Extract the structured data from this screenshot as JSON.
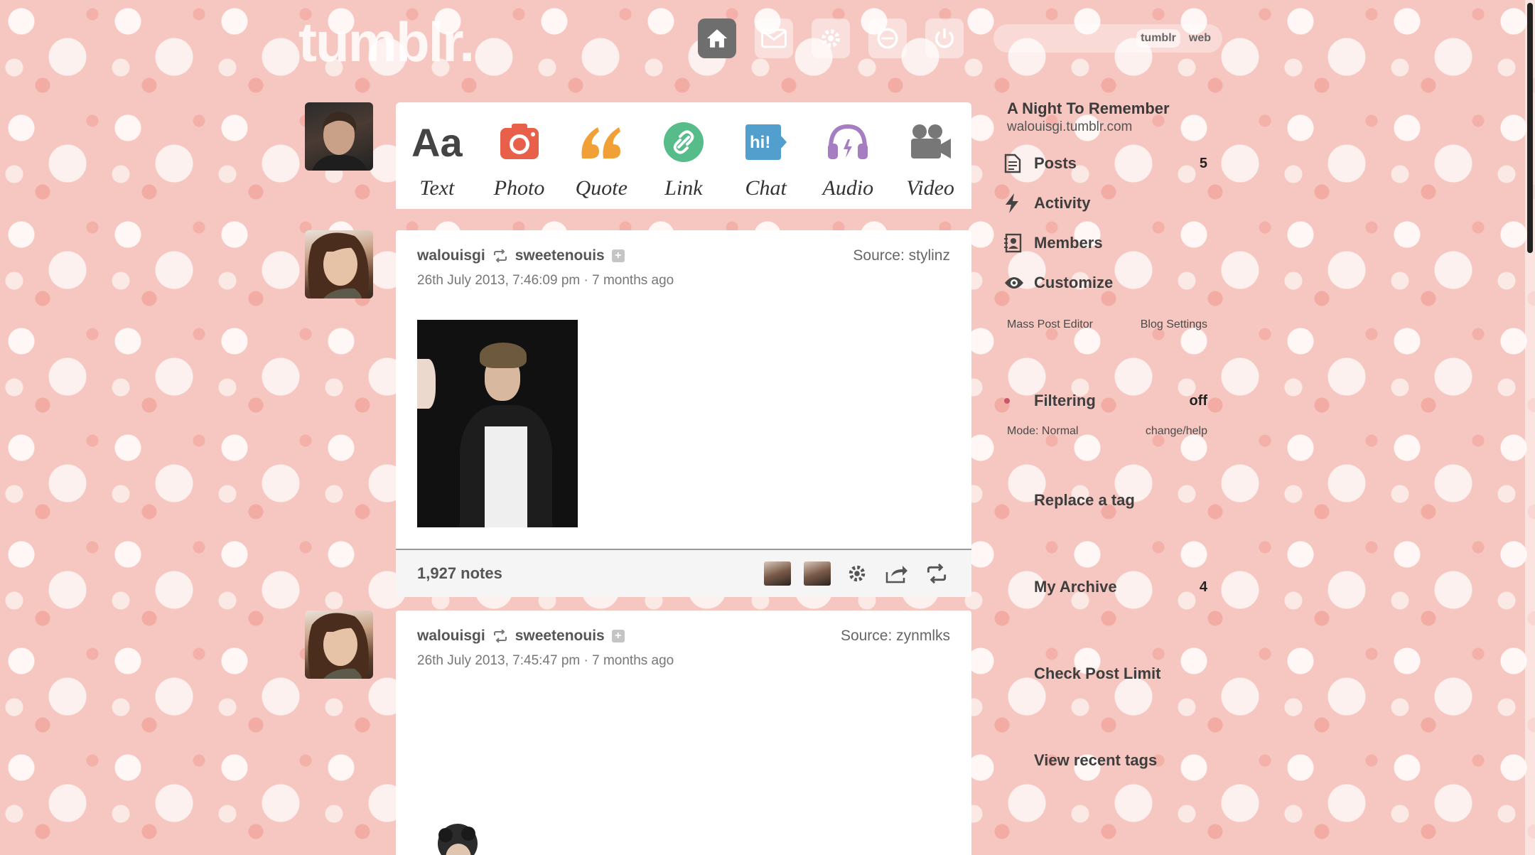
{
  "header": {
    "logo": "tumblr.",
    "nav": [
      {
        "name": "dashboard",
        "icon": "home-icon"
      },
      {
        "name": "inbox",
        "icon": "envelope-icon"
      },
      {
        "name": "settings",
        "icon": "gear-icon"
      },
      {
        "name": "help",
        "icon": "circle-icon"
      },
      {
        "name": "log-out",
        "icon": "power-icon"
      }
    ],
    "search": {
      "placeholder": "",
      "tumblr_label": "tumblr",
      "web_label": "web"
    }
  },
  "post_types": [
    {
      "label": "Text",
      "icon": "text-icon",
      "color": "#444444"
    },
    {
      "label": "Photo",
      "icon": "camera-icon",
      "color": "#e8604a"
    },
    {
      "label": "Quote",
      "icon": "quote-icon",
      "color": "#f0a035"
    },
    {
      "label": "Link",
      "icon": "link-icon",
      "color": "#56bc8a"
    },
    {
      "label": "Chat",
      "icon": "chat-icon",
      "color": "#529ecc"
    },
    {
      "label": "Audio",
      "icon": "headphones-icon",
      "color": "#a77dc2"
    },
    {
      "label": "Video",
      "icon": "video-camera-icon",
      "color": "#777777"
    }
  ],
  "posts": [
    {
      "author": "walouisgi",
      "reblogged_from": "sweetenouis",
      "date": "26th July 2013, 7:46:09 pm",
      "ago": "7 months ago",
      "source_label": "Source:",
      "source": "stylinz",
      "notes": "1,927 notes"
    },
    {
      "author": "walouisgi",
      "reblogged_from": "sweetenouis",
      "date": "26th July 2013, 7:45:47 pm",
      "ago": "7 months ago",
      "source_label": "Source:",
      "source": "zynmlks"
    }
  ],
  "sidebar": {
    "blog_title": "A Night To Remember",
    "blog_url": "walouisgi.tumblr.com",
    "menu": [
      {
        "label": "Posts",
        "count": "5",
        "icon": "document-icon"
      },
      {
        "label": "Activity",
        "count": "",
        "icon": "lightning-icon"
      },
      {
        "label": "Members",
        "count": "",
        "icon": "members-icon"
      },
      {
        "label": "Customize",
        "count": "",
        "icon": "eye-icon"
      }
    ],
    "mass_post_editor": "Mass Post Editor",
    "blog_settings": "Blog Settings",
    "filtering": {
      "label": "Filtering",
      "state": "off",
      "mode": "Mode: Normal",
      "help": "change/help"
    },
    "replace_tag": "Replace a tag",
    "my_archive": {
      "label": "My Archive",
      "count": "4"
    },
    "check_post_limit": "Check Post Limit",
    "view_recent_tags": "View recent tags"
  }
}
